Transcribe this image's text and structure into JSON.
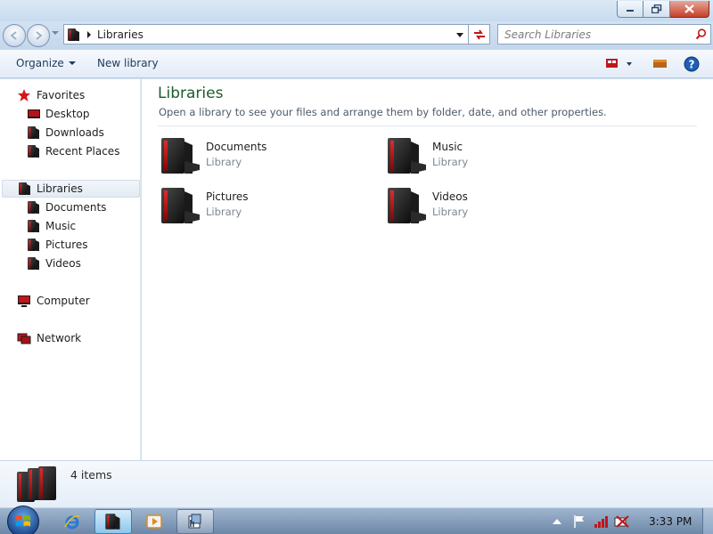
{
  "window": {
    "minimize_icon": "minimize-icon",
    "maximize_icon": "restore-icon",
    "close_icon": "close-icon"
  },
  "address": {
    "path": "Libraries",
    "search_placeholder": "Search Libraries"
  },
  "toolbar": {
    "organize_label": "Organize",
    "new_library_label": "New library"
  },
  "nav": {
    "favorites": "Favorites",
    "desktop": "Desktop",
    "downloads": "Downloads",
    "recent_places": "Recent Places",
    "libraries": "Libraries",
    "documents": "Documents",
    "music": "Music",
    "pictures": "Pictures",
    "videos": "Videos",
    "computer": "Computer",
    "network": "Network"
  },
  "content": {
    "title": "Libraries",
    "subtitle": "Open a library to see your files and arrange them by folder, date, and other properties.",
    "libraries": [
      {
        "name": "Documents",
        "type": "Library"
      },
      {
        "name": "Music",
        "type": "Library"
      },
      {
        "name": "Pictures",
        "type": "Library"
      },
      {
        "name": "Videos",
        "type": "Library"
      }
    ]
  },
  "details": {
    "count": "4 items"
  },
  "taskbar": {
    "clock": "3:33 PM"
  },
  "colors": {
    "accent_red": "#c0161a",
    "title_green": "#1e5c2e",
    "chrome_blue": "#c7dbef"
  }
}
